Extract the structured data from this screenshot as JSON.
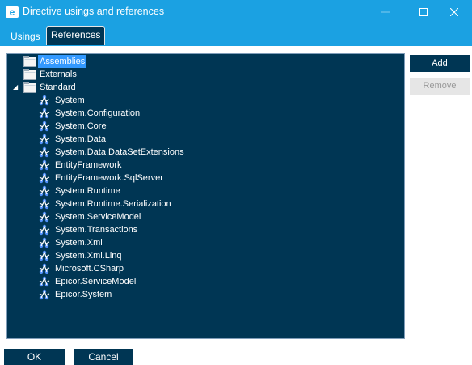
{
  "window": {
    "title": "Directive usings and references",
    "icon_letter": "e"
  },
  "tabs": [
    {
      "label": "Usings",
      "active": false
    },
    {
      "label": "References",
      "active": true
    }
  ],
  "tree": {
    "folders": [
      {
        "label": "Assemblies",
        "selected": true,
        "expanded": false
      },
      {
        "label": "Externals",
        "selected": false,
        "expanded": false
      },
      {
        "label": "Standard",
        "selected": false,
        "expanded": true
      }
    ],
    "standard_children": [
      "System",
      "System.Configuration",
      "System.Core",
      "System.Data",
      "System.Data.DataSetExtensions",
      "EntityFramework",
      "EntityFramework.SqlServer",
      "System.Runtime",
      "System.Runtime.Serialization",
      "System.ServiceModel",
      "System.Transactions",
      "System.Xml",
      "System.Xml.Linq",
      "Microsoft.CSharp",
      "Epicor.ServiceModel",
      "Epicor.System"
    ]
  },
  "buttons": {
    "add": "Add",
    "remove": "Remove",
    "ok": "OK",
    "cancel": "Cancel"
  },
  "colors": {
    "accent": "#1ba1e2",
    "panel": "#003654",
    "selection": "#3399ff",
    "disabled": "#e6e6e6"
  }
}
